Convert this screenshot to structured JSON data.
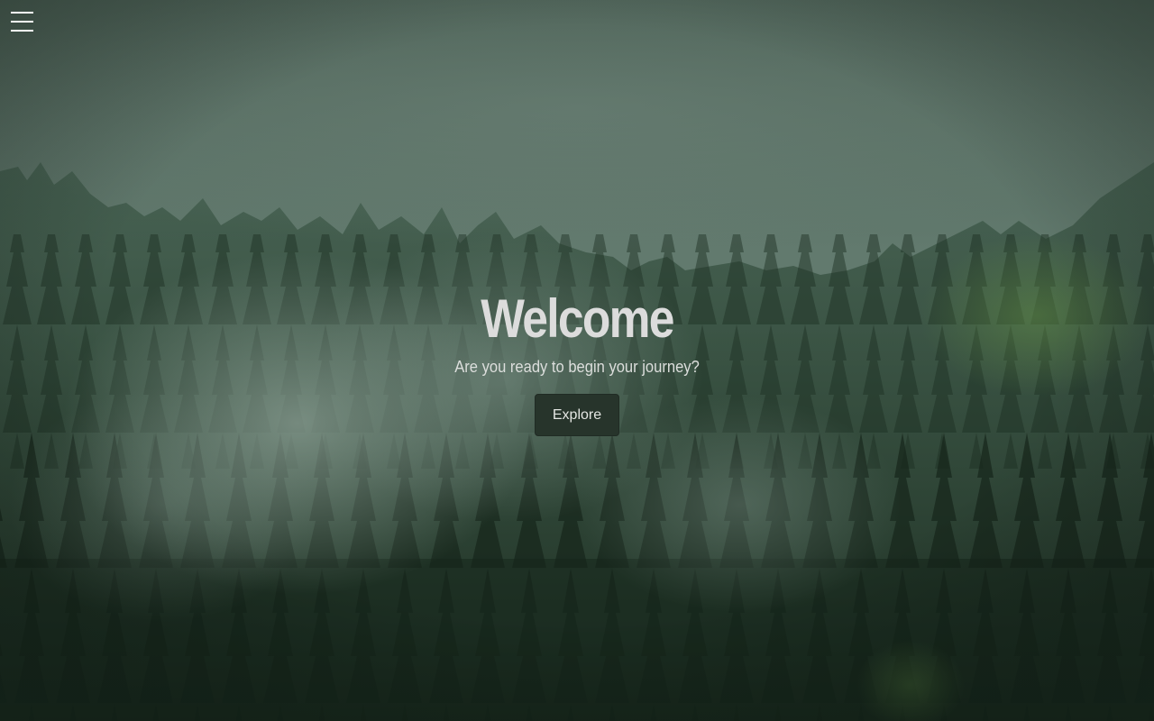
{
  "hero": {
    "title": "Welcome",
    "subtitle": "Are you ready to begin your journey?",
    "button_label": "Explore"
  },
  "nav": {
    "menu_icon": "hamburger-menu-icon"
  },
  "colors": {
    "sky": "#61766b",
    "forest_dark": "#1f3225",
    "forest_mid": "#2c4433",
    "mist": "#7d9287",
    "button_bg": "#27342b",
    "title_text": "#dcdcdc"
  }
}
